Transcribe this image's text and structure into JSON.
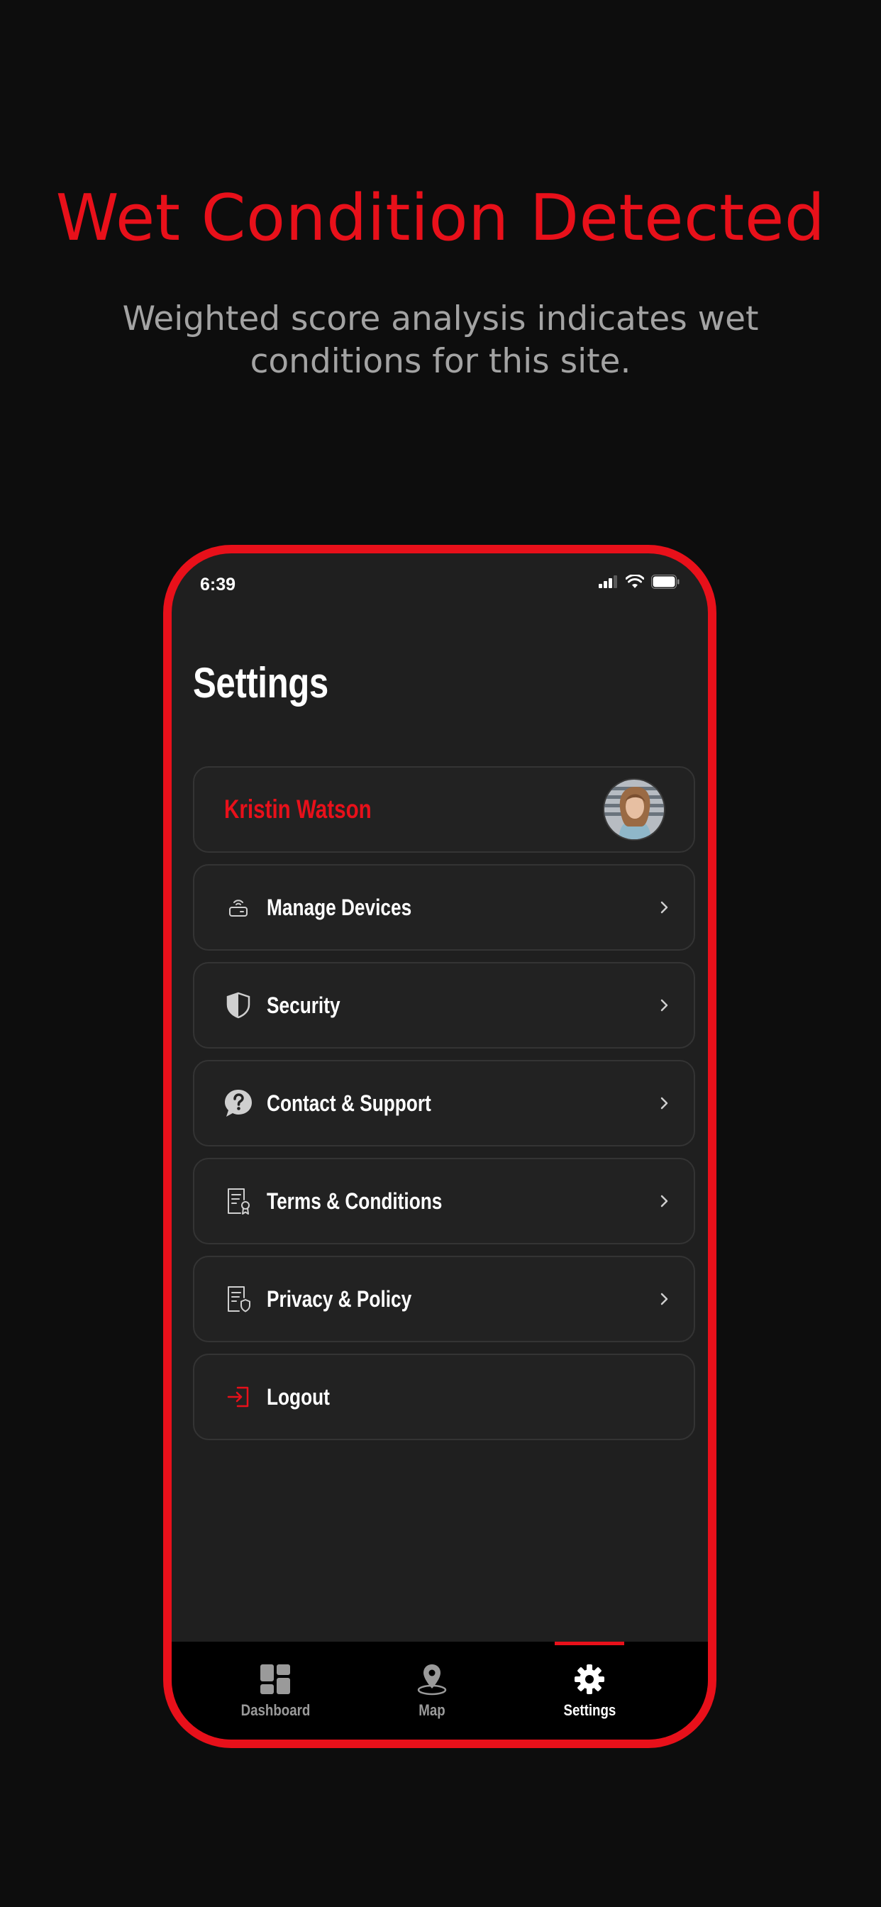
{
  "hero": {
    "headline": "Wet Condition Detected",
    "subtext": "Weighted score analysis indicates wet conditions for this site."
  },
  "status_bar": {
    "time": "6:39"
  },
  "screen": {
    "title": "Settings"
  },
  "profile": {
    "name": "Kristin Watson"
  },
  "menu": {
    "items": [
      {
        "label": "Manage Devices",
        "icon": "router-icon"
      },
      {
        "label": "Security",
        "icon": "shield-icon"
      },
      {
        "label": "Contact & Support",
        "icon": "help-bubble-icon"
      },
      {
        "label": "Terms & Conditions",
        "icon": "certificate-document-icon"
      },
      {
        "label": "Privacy & Policy",
        "icon": "privacy-document-icon"
      },
      {
        "label": "Logout",
        "icon": "logout-icon"
      }
    ]
  },
  "tabbar": {
    "tabs": [
      {
        "label": "Dashboard",
        "icon": "dashboard-icon",
        "active": false
      },
      {
        "label": "Map",
        "icon": "map-pin-icon",
        "active": false
      },
      {
        "label": "Settings",
        "icon": "gear-icon",
        "active": true
      }
    ]
  },
  "colors": {
    "accent": "#e8101a",
    "background": "#0d0d0d",
    "screen": "#1f1f1f",
    "card": "#222222",
    "muted_text": "#a3a3a3",
    "inactive_tab": "#9a9a9a"
  }
}
